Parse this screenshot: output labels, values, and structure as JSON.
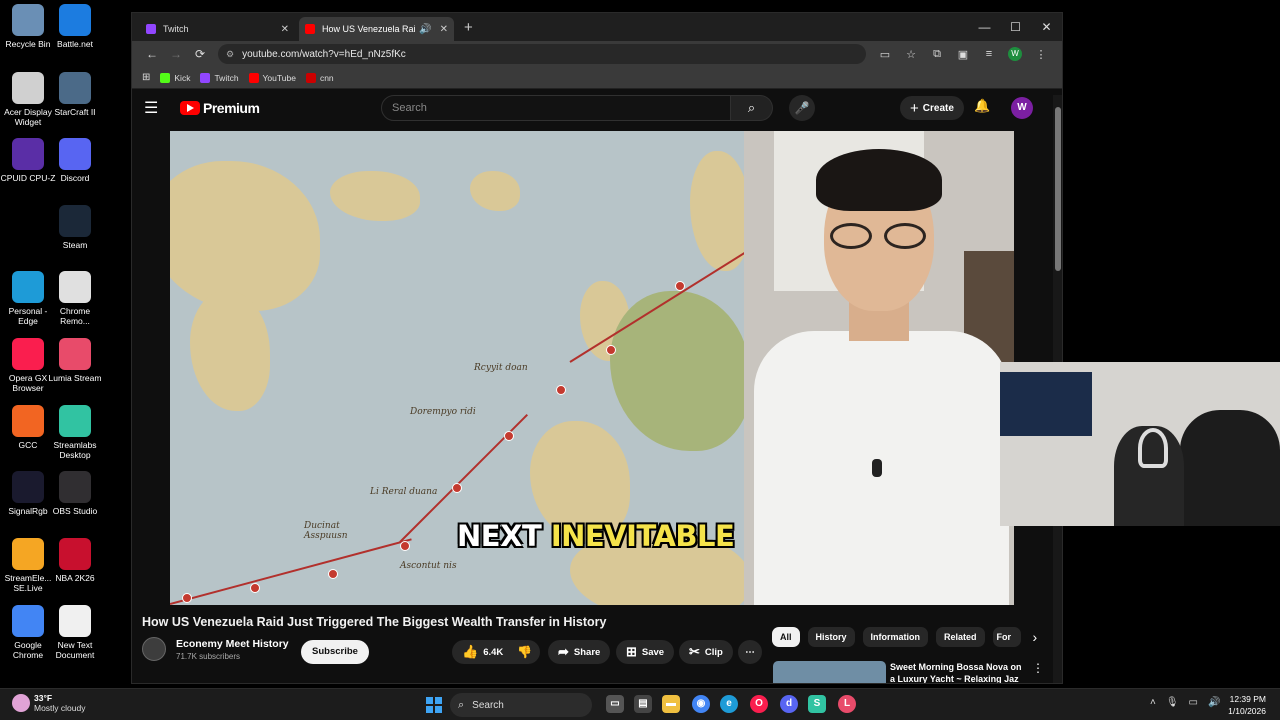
{
  "desktop": {
    "icons": [
      {
        "label": "Recycle Bin",
        "icon": "recycle-bin-icon",
        "color": "#6a8fb5"
      },
      {
        "label": "Battle.net",
        "icon": "battlenet-icon",
        "color": "#1c7ce0"
      },
      {
        "label": "Acer Display Widget",
        "icon": "acer-display-icon",
        "color": "#d0d0d0"
      },
      {
        "label": "StarCraft II",
        "icon": "starcraft-icon",
        "color": "#4b6a88"
      },
      {
        "label": "CPUID CPU-Z",
        "icon": "cpuz-icon",
        "color": "#5a2ea6"
      },
      {
        "label": "Discord",
        "icon": "discord-icon",
        "color": "#5865f2"
      },
      {
        "label": "Steam",
        "icon": "steam-icon",
        "color": "#1b2838"
      },
      {
        "label": "Personal - Edge",
        "icon": "edge-icon",
        "color": "#1e9bd7"
      },
      {
        "label": "Chrome Remo...",
        "icon": "chrome-remote-icon",
        "color": "#e0e0e0"
      },
      {
        "label": "Opera GX Browser",
        "icon": "opera-gx-icon",
        "color": "#fa1e4e"
      },
      {
        "label": "Lumia Stream",
        "icon": "lumia-stream-icon",
        "color": "#e84b6a"
      },
      {
        "label": "GCC",
        "icon": "gcc-icon",
        "color": "#f26522"
      },
      {
        "label": "Streamlabs Desktop",
        "icon": "streamlabs-icon",
        "color": "#31c3a2"
      },
      {
        "label": "SignalRgb",
        "icon": "signalrgb-icon",
        "color": "#1a1a2e"
      },
      {
        "label": "OBS Studio",
        "icon": "obs-icon",
        "color": "#302e31"
      },
      {
        "label": "StreamEle... SE.Live",
        "icon": "streamelements-icon",
        "color": "#f5a623"
      },
      {
        "label": "NBA 2K26",
        "icon": "nba2k-icon",
        "color": "#c8102e"
      },
      {
        "label": "Google Chrome",
        "icon": "chrome-icon",
        "color": "#4285f4"
      },
      {
        "label": "New Text Document",
        "icon": "text-document-icon",
        "color": "#f0f0f0"
      }
    ]
  },
  "browser": {
    "tabs": [
      {
        "title": "Twitch",
        "favicon_color": "#9146ff",
        "active": false
      },
      {
        "title": "How US Venezuela Raid Ju",
        "favicon_color": "#ff0000",
        "active": true
      }
    ],
    "window_controls": {
      "minimize": "—",
      "maximize": "☐",
      "close": "✕"
    },
    "url": "youtube.com/watch?v=hEd_nNz5fKc",
    "profile_initial": "W",
    "bookmarks": [
      {
        "label": "Kick",
        "color": "#53fc18"
      },
      {
        "label": "Twitch",
        "color": "#9146ff"
      },
      {
        "label": "YouTube",
        "color": "#ff0000"
      },
      {
        "label": "cnn",
        "color": "#cc0000"
      }
    ]
  },
  "youtube": {
    "logo_text": "Premium",
    "search_placeholder": "Search",
    "create_label": "Create",
    "avatar_initial": "W",
    "video": {
      "caption_word1": "NEXT",
      "caption_word2": "INEVITABLE",
      "map_labels": [
        "Rcyyit doan",
        "Dorempyo ridi",
        "Li Reral duana",
        "Ducinat Asspuusn",
        "Ascontut nis"
      ]
    },
    "title": "How US Venezuela Raid Just Triggered The Biggest Wealth Transfer in History",
    "channel_name": "Econemy Meet History",
    "subscribers": "71.7K subscribers",
    "subscribe_label": "Subscribe",
    "likes": "6.4K",
    "share_label": "Share",
    "save_label": "Save",
    "clip_label": "Clip",
    "chips": [
      "All",
      "History",
      "Information",
      "Related",
      "For"
    ],
    "recommended_title": "Sweet Morning Bossa Nova on a Luxury Yacht ~ Relaxing Jaz"
  },
  "taskbar": {
    "temperature": "33°F",
    "weather": "Mostly cloudy",
    "search_placeholder": "Search",
    "time": "12:39 PM",
    "date": "1/10/2026"
  }
}
